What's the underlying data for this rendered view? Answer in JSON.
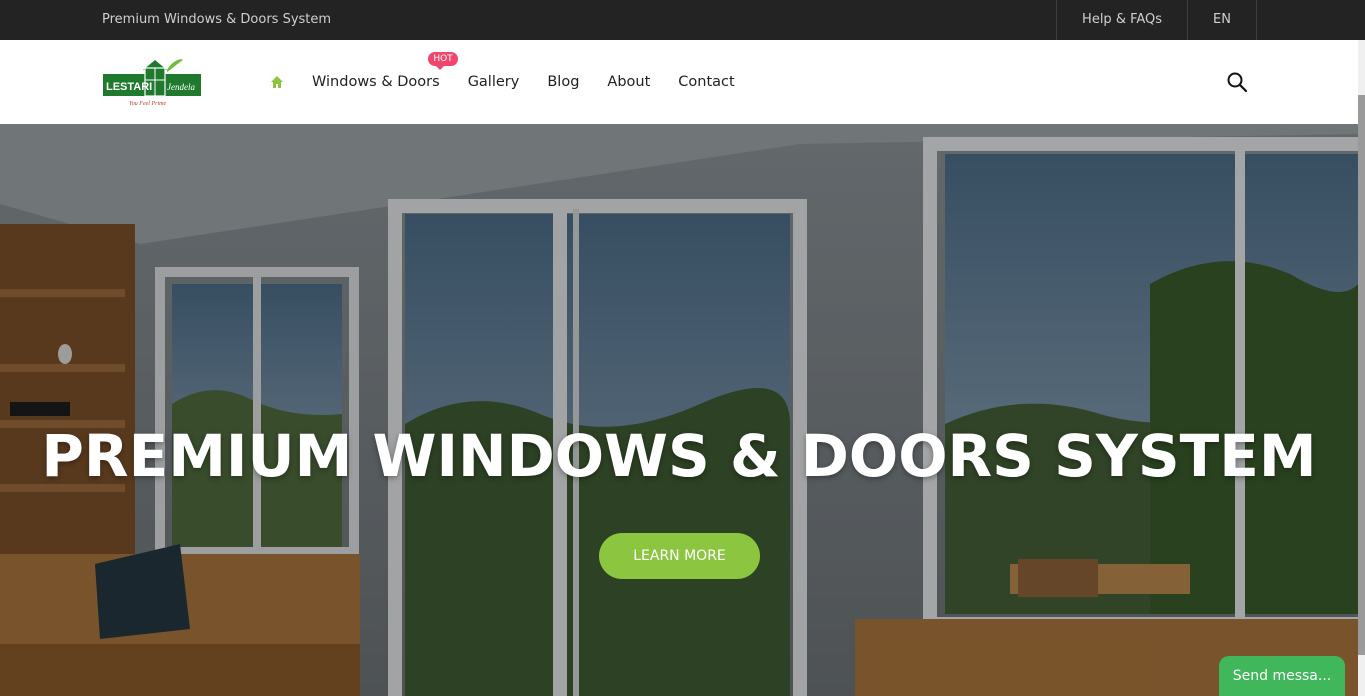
{
  "topbar": {
    "tagline": "Premium Windows & Doors System",
    "help_label": "Help & FAQs",
    "lang_label": "EN"
  },
  "logo": {
    "brand": "LESTARI",
    "sub": "Jendela",
    "slogan": "You Feel Prime"
  },
  "nav": {
    "items": [
      "Windows & Doors",
      "Gallery",
      "Blog",
      "About",
      "Contact"
    ],
    "hot_badge": "HOT"
  },
  "hero": {
    "title": "PREMIUM WINDOWS & DOORS SYSTEM",
    "cta_label": "LEARN MORE"
  },
  "chat": {
    "send_label": "Send messa..."
  },
  "colors": {
    "accent_green": "#8cc540",
    "hot_pink": "#f2456d",
    "chat_green": "#40b75a",
    "topbar_bg": "#232323"
  },
  "icons": [
    "home-icon",
    "search-icon"
  ]
}
